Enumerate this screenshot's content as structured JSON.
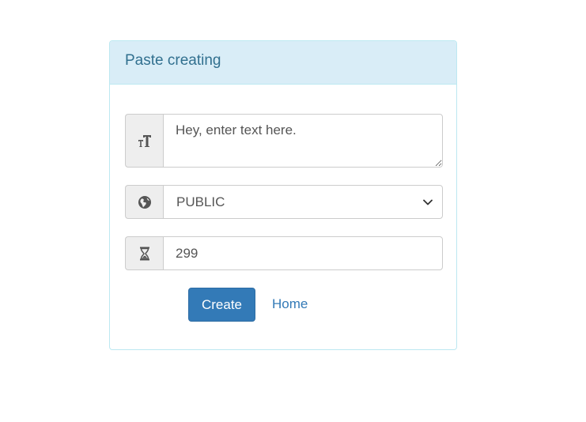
{
  "panel": {
    "title": "Paste creating"
  },
  "text_field": {
    "icon": "text-size-icon",
    "placeholder": "Hey, enter text here."
  },
  "visibility_select": {
    "icon": "globe-icon",
    "selected": "PUBLIC"
  },
  "expiration_field": {
    "icon": "hourglass-icon",
    "value": "299"
  },
  "actions": {
    "create_label": "Create",
    "home_label": "Home"
  },
  "colors": {
    "heading_bg": "#d9edf7",
    "heading_text": "#31708f",
    "primary": "#337ab7"
  }
}
